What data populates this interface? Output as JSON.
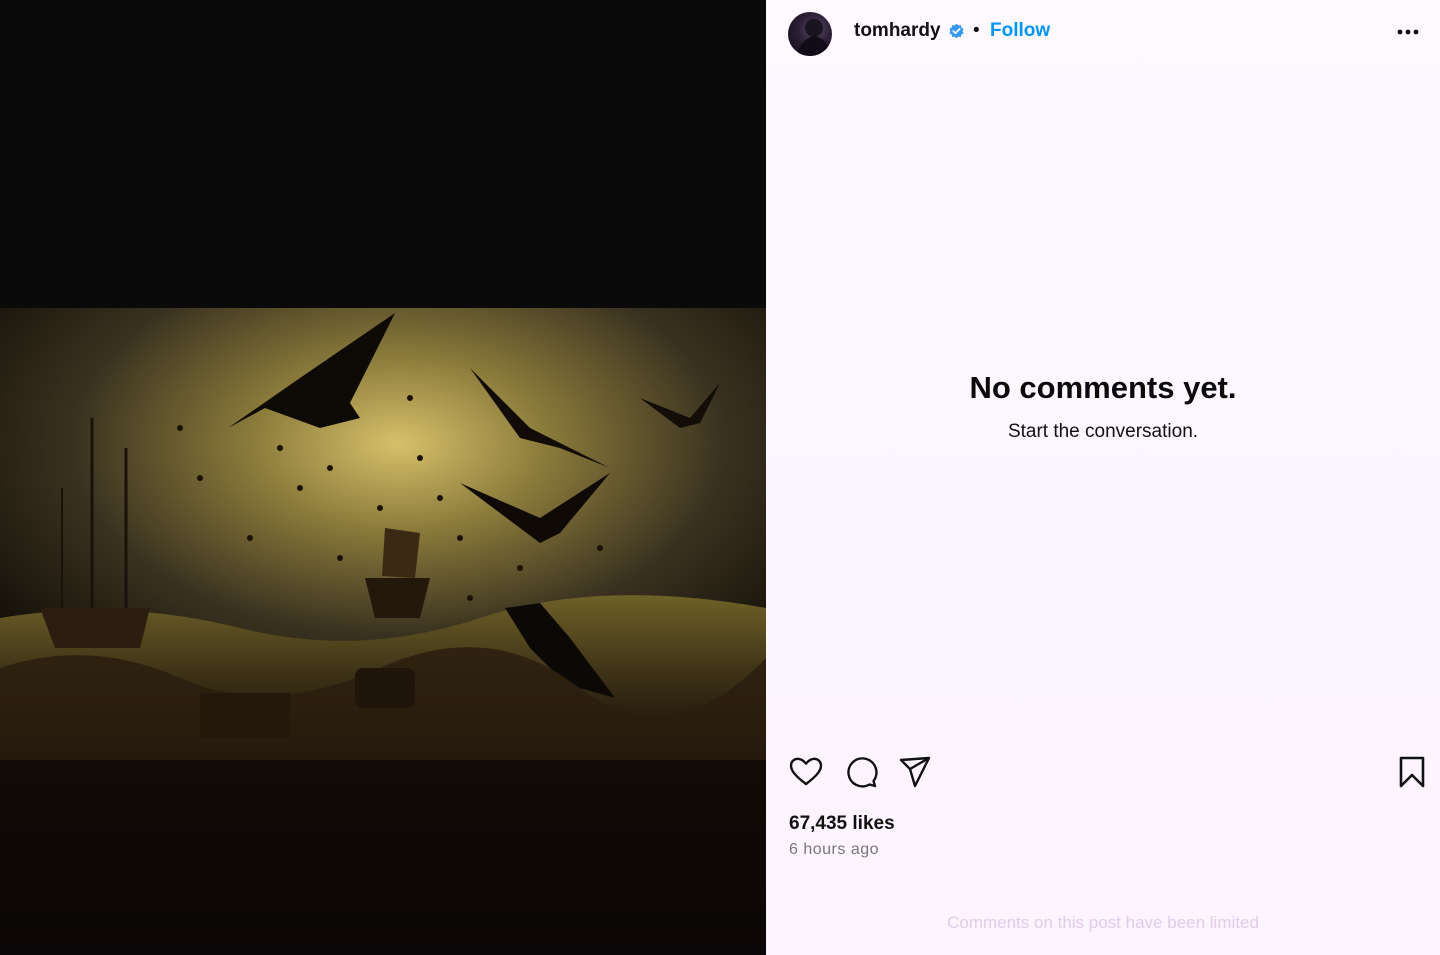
{
  "post": {
    "username": "tomhardy",
    "separator": "•",
    "follow_label": "Follow",
    "more_icon": "more-options-icon",
    "verified_icon": "verified-badge-icon"
  },
  "comments": {
    "empty_title": "No comments yet.",
    "empty_subtitle": "Start the conversation.",
    "limited_notice": "Comments on this post have been limited"
  },
  "actions": {
    "icons": [
      "heart-icon",
      "comment-icon",
      "share-icon",
      "bookmark-icon"
    ]
  },
  "stats": {
    "likes": "67,435 likes",
    "posted": "6 hours ago"
  },
  "colors": {
    "link": "#0095f6",
    "panel_bg": "#fdf9ff",
    "media_bg": "#070707"
  }
}
